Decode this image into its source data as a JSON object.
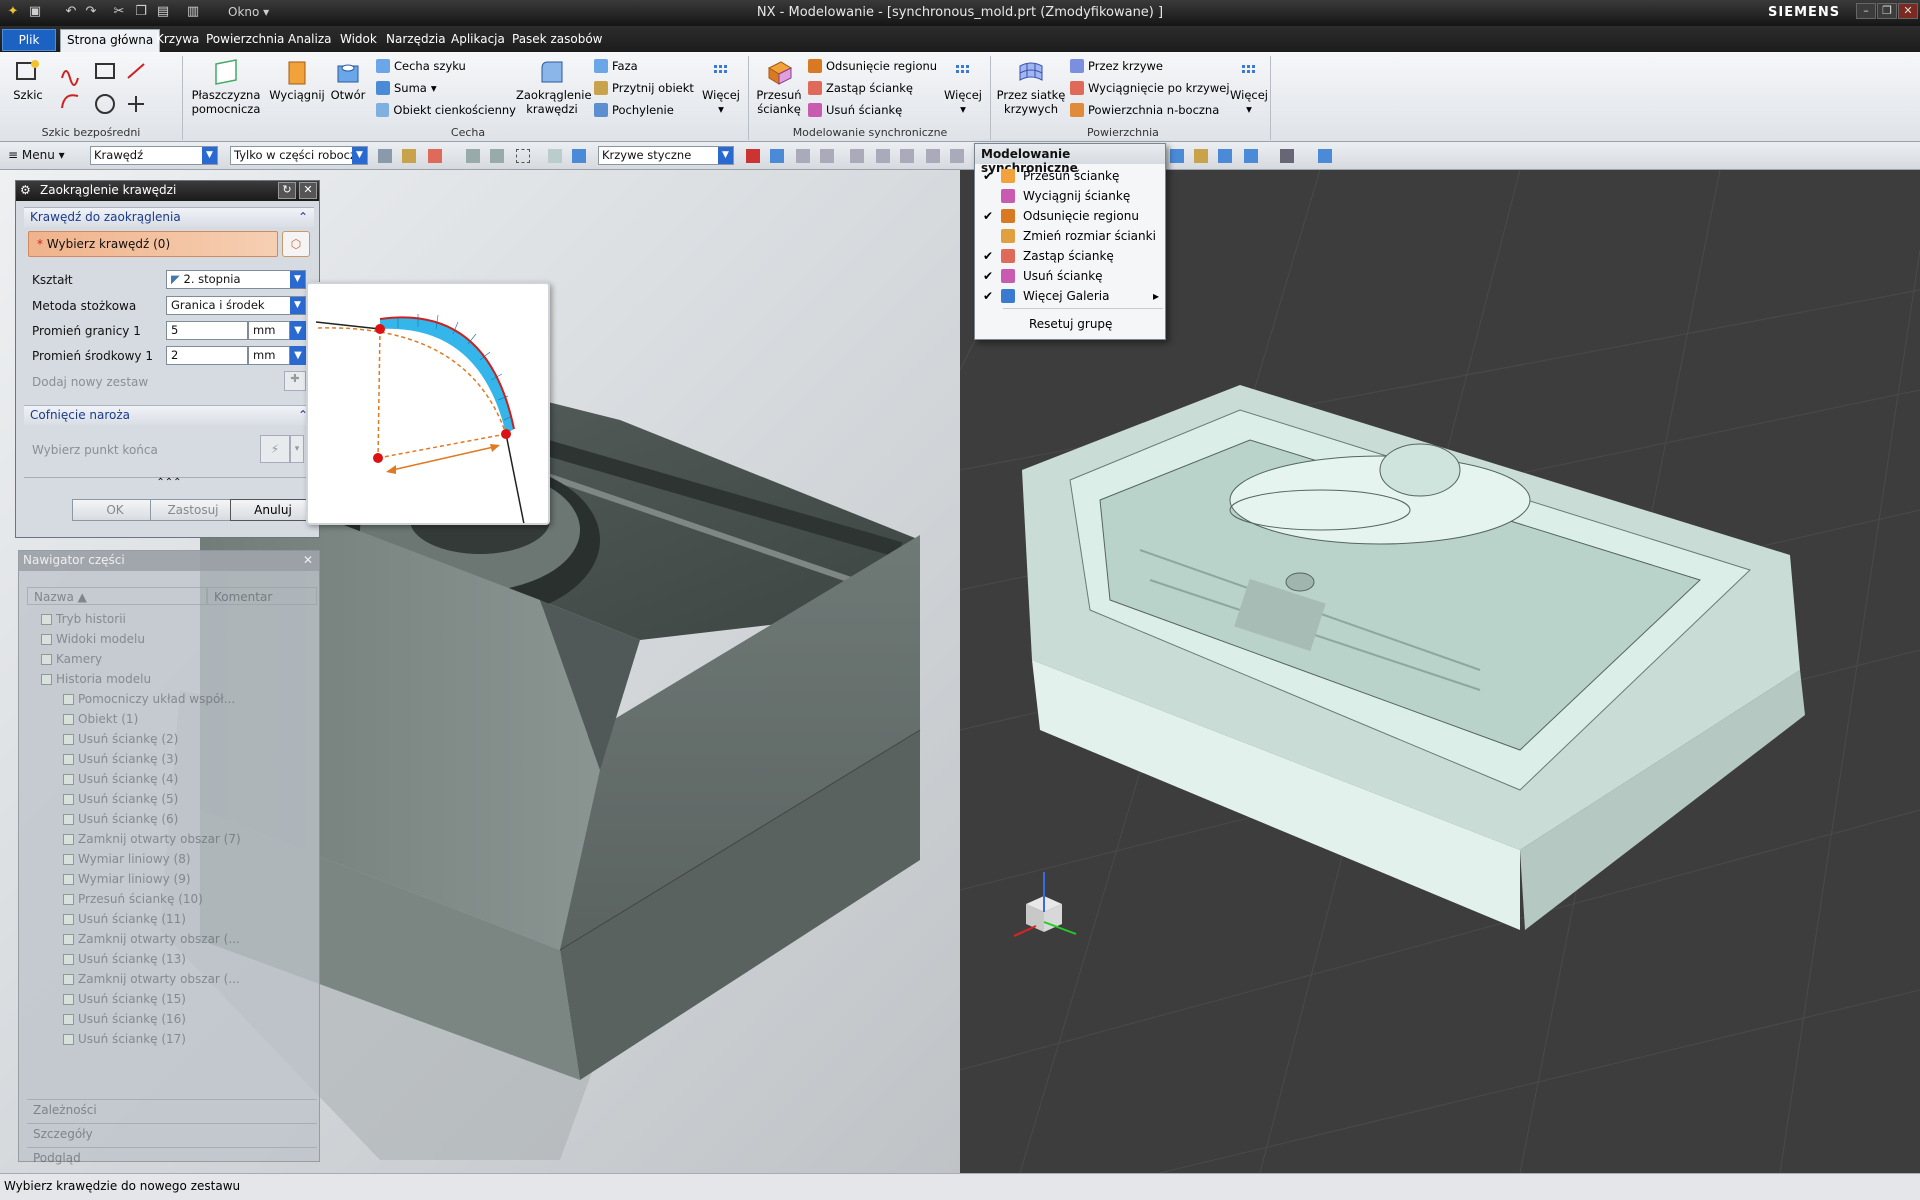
{
  "window": {
    "title": "NX - Modelowanie - [synchronous_mold.prt (Zmodyfikowane) ]",
    "brand": "SIEMENS",
    "okno_label": "Okno"
  },
  "menubar": {
    "tabs": [
      "Plik",
      "Strona główna",
      "Krzywa",
      "Powierzchnia",
      "Analiza",
      "Widok",
      "Narzędzia",
      "Aplikacja",
      "Pasek zasobów"
    ],
    "layout_value": "layout"
  },
  "ribbon": {
    "sketch_group": {
      "label": "Szkic bezpośredni",
      "big": "Szkic"
    },
    "feature_group": {
      "label": "Cecha",
      "plane": "Płaszczyzna pomocnicza",
      "extrude": "Wyciągnij",
      "hole": "Otwór",
      "small": [
        "Cecha szyku",
        "Suma",
        "Obiekt cienkościenny"
      ],
      "round": "Zaokrąglenie krawędzi",
      "small2": [
        "Faza",
        "Przytnij obiekt",
        "Pochylenie"
      ],
      "more": "Więcej"
    },
    "sync_group": {
      "label": "Modelowanie synchroniczne",
      "move": "Przesuń ściankę",
      "small": [
        "Odsunięcie regionu",
        "Zastąp ściankę",
        "Usuń ściankę"
      ],
      "more": "Więcej"
    },
    "surface_group": {
      "label": "Powierzchnia",
      "mesh": "Przez siatkę krzywych",
      "small": [
        "Przez krzywe",
        "Wyciągnięcie po krzywej",
        "Powierzchnia n-boczna"
      ],
      "more": "Więcej"
    }
  },
  "toolbar2": {
    "menu_label": "Menu",
    "filter_type": "Krawędź",
    "scope": "Tylko w części robocz",
    "curve_rule": "Krzywe styczne"
  },
  "dialog": {
    "title": "Zaokrąglenie krawędzi",
    "section1": "Krawędź do zaokrąglenia",
    "select_edge": "Wybierz krawędź (0)",
    "shape_label": "Kształt",
    "shape_value": "2. stopnia",
    "method_label": "Metoda stożkowa",
    "method_value": "Granica i środek",
    "r1_label": "Promień granicy 1",
    "r1_value": "5",
    "r1_unit": "mm",
    "rc_label": "Promień środkowy 1",
    "rc_value": "2",
    "rc_unit": "mm",
    "add_set": "Dodaj nowy zestaw",
    "section2": "Cofnięcie naroża",
    "select_point": "Wybierz punkt końca",
    "ok": "OK",
    "apply": "Zastosuj",
    "cancel": "Anuluj"
  },
  "navigator": {
    "title": "Nawigator części",
    "col_name": "Nazwa",
    "col_comment": "Komentar",
    "rows": [
      "Tryb historii",
      "Widoki modelu",
      "Kamery",
      "Historia modelu",
      "Pomocniczy układ współ...",
      "Obiekt (1)",
      "Usuń ściankę (2)",
      "Usuń ściankę (3)",
      "Usuń ściankę (4)",
      "Usuń ściankę (5)",
      "Usuń ściankę (6)",
      "Zamknij otwarty obszar (7)",
      "Wymiar liniowy (8)",
      "Wymiar liniowy (9)",
      "Przesuń ściankę (10)",
      "Usuń ściankę (11)",
      "Zamknij otwarty obszar (...",
      "Usuń ściankę (13)",
      "Zamknij otwarty obszar (...",
      "Usuń ściankę (15)",
      "Usuń ściankę (16)",
      "Usuń ściankę (17)"
    ],
    "footers": [
      "Zależności",
      "Szczegóły",
      "Podgląd"
    ]
  },
  "popup": {
    "header": "Modelowanie synchroniczne",
    "items": [
      {
        "label": "Przesuń ściankę",
        "checked": "✔"
      },
      {
        "label": "Wyciągnij ściankę",
        "checked": ""
      },
      {
        "label": "Odsunięcie regionu",
        "checked": "✔"
      },
      {
        "label": "Zmień rozmiar ścianki",
        "checked": ""
      },
      {
        "label": "Zastąp ściankę",
        "checked": "✔"
      },
      {
        "label": "Usuń ściankę",
        "checked": "✔"
      },
      {
        "label": "Więcej Galeria",
        "checked": "✔"
      }
    ],
    "reset": "Resetuj grupę"
  },
  "status": {
    "text": "Wybierz krawędzie do nowego zestawu"
  },
  "colors": {
    "accent": "#1c62c2",
    "selection": "#f2b38a",
    "model_light": "#d9eee6",
    "model_dark": "#5f6b66"
  }
}
